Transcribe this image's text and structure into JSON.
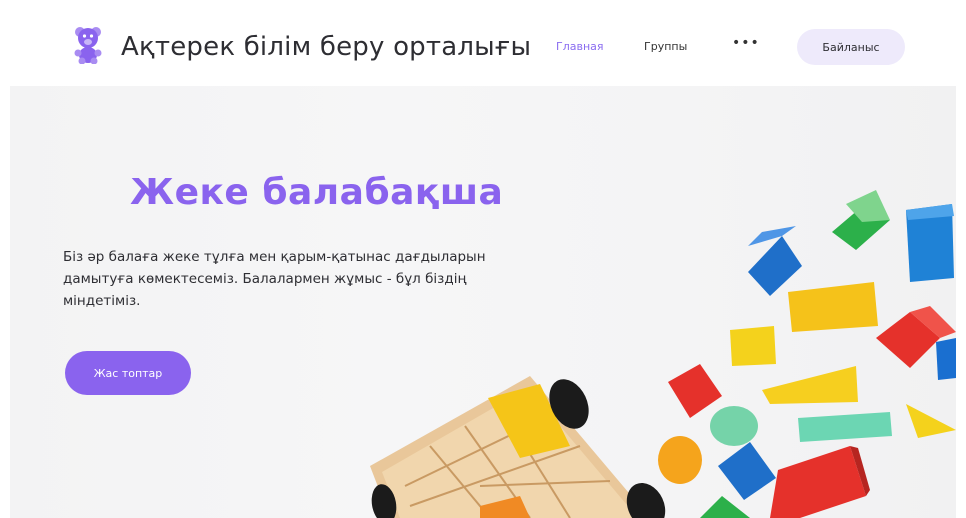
{
  "header": {
    "brand": "Ақтерек білім беру орталығы",
    "nav": {
      "home": "Главная",
      "groups": "Группы",
      "more": "•••"
    },
    "contact_label": "Байланыс"
  },
  "hero": {
    "title": "Жеке балабақша",
    "description": "Біз әр балаға жеке тұлға мен қарым-қатынас дағдыларын дамытуға көмектесеміз. Балалармен жұмыс - бұл біздің міндетіміз.",
    "button_label": "Жас топтар"
  },
  "colors": {
    "accent": "#8a63ee",
    "contact_bg": "#eeeafb"
  },
  "icons": {
    "logo": "teddy-bear-icon"
  }
}
